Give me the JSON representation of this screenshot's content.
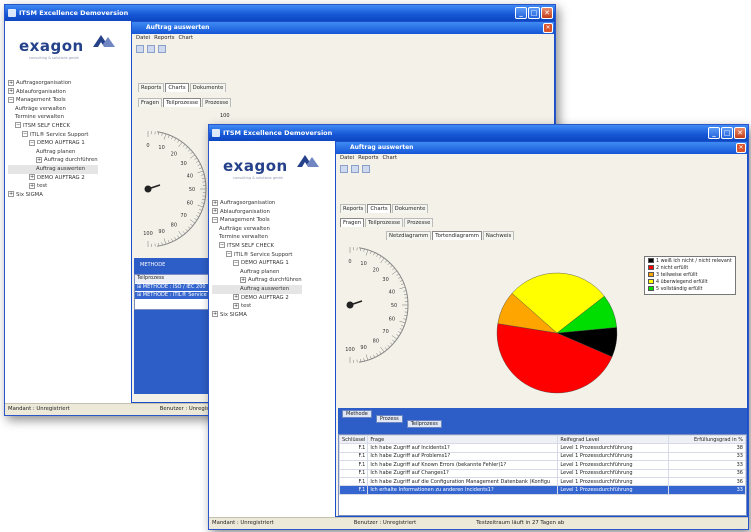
{
  "back": {
    "title": "ITSM Excellence Demoversion",
    "brand": "exagon",
    "tagline": "consulting & solutions gmbh",
    "tree": [
      {
        "label": "Auftragsorganisation",
        "exp": "+",
        "indent": 0
      },
      {
        "label": "Ablauforganisation",
        "exp": "+",
        "indent": 0
      },
      {
        "label": "Management Tools",
        "exp": "−",
        "indent": 0
      },
      {
        "label": "Aufträge verwalten",
        "exp": "",
        "indent": 1
      },
      {
        "label": "Termine verwalten",
        "exp": "",
        "indent": 1
      },
      {
        "label": "ITSM SELF CHECK",
        "exp": "−",
        "indent": 1
      },
      {
        "label": "ITIL® Service Support",
        "exp": "−",
        "indent": 2
      },
      {
        "label": "DEMO AUFTRAG 1",
        "exp": "−",
        "indent": 3
      },
      {
        "label": "Auftrag planen",
        "exp": "",
        "indent": 4
      },
      {
        "label": "Auftrag durchführen",
        "exp": "+",
        "indent": 4
      },
      {
        "label": "Auftrag auswerten",
        "exp": "",
        "indent": 4,
        "sel": true
      },
      {
        "label": "DEMO AUFTRAG 2",
        "exp": "+",
        "indent": 3
      },
      {
        "label": "test",
        "exp": "+",
        "indent": 3
      },
      {
        "label": "Six SIGMA",
        "exp": "+",
        "indent": 0
      }
    ],
    "child_title": "Auftrag auswerten",
    "menu": [
      "Datei",
      "Reports",
      "Chart"
    ],
    "tabs1": [
      "Reports",
      "Charts",
      "Dokumente"
    ],
    "tabs2": [
      "Fragen",
      "Teilprozesse",
      "Prozesse"
    ],
    "top_value": "100",
    "gauge_ticks": [
      "0",
      "10",
      "20",
      "30",
      "40",
      "50",
      "60",
      "70",
      "80",
      "90",
      "100"
    ],
    "grid_label": "METHODE",
    "grid_header": "Teilprozess",
    "grid_rows": [
      "METHODE : ISO / IEC 200",
      "METHODE : ITIL® Service"
    ],
    "status": [
      "Mandant : Unregistriert",
      "Benutzer : Unregistriert"
    ]
  },
  "front": {
    "title": "ITSM Excellence Demoversion",
    "brand": "exagon",
    "tagline": "consulting & solutions gmbh",
    "tree": [
      {
        "label": "Auftragsorganisation",
        "exp": "+",
        "indent": 0
      },
      {
        "label": "Ablauforganisation",
        "exp": "+",
        "indent": 0
      },
      {
        "label": "Management Tools",
        "exp": "−",
        "indent": 0
      },
      {
        "label": "Aufträge verwalten",
        "exp": "",
        "indent": 1
      },
      {
        "label": "Termine verwalten",
        "exp": "",
        "indent": 1
      },
      {
        "label": "ITSM SELF CHECK",
        "exp": "−",
        "indent": 1
      },
      {
        "label": "ITIL® Service Support",
        "exp": "−",
        "indent": 2
      },
      {
        "label": "DEMO AUFTRAG 1",
        "exp": "−",
        "indent": 3
      },
      {
        "label": "Auftrag planen",
        "exp": "",
        "indent": 4
      },
      {
        "label": "Auftrag durchführen",
        "exp": "+",
        "indent": 4
      },
      {
        "label": "Auftrag auswerten",
        "exp": "",
        "indent": 4,
        "sel": true
      },
      {
        "label": "DEMO AUFTRAG 2",
        "exp": "+",
        "indent": 3
      },
      {
        "label": "test",
        "exp": "+",
        "indent": 3
      },
      {
        "label": "Six SIGMA",
        "exp": "+",
        "indent": 0
      }
    ],
    "child_title": "Auftrag auswerten",
    "menu": [
      "Datei",
      "Reports",
      "Chart"
    ],
    "tabs1": [
      "Reports",
      "Charts",
      "Dokumente"
    ],
    "tabs2": [
      "Fragen",
      "Teilprozesse",
      "Prozesse"
    ],
    "tabs3": [
      "Netzdiagramm",
      "Tortendiagramm",
      "Nachweis"
    ],
    "gauge_ticks": [
      "0",
      "10",
      "20",
      "30",
      "40",
      "50",
      "60",
      "70",
      "80",
      "90",
      "100"
    ],
    "legend": [
      {
        "label": "1 weiß ich nicht / nicht relevant",
        "color": "#000000"
      },
      {
        "label": "2 nicht erfüllt",
        "color": "#ff0000"
      },
      {
        "label": "3 teilweise erfüllt",
        "color": "#ffa500"
      },
      {
        "label": "4 überwiegend erfüllt",
        "color": "#ffff00"
      },
      {
        "label": "5 vollständig erfüllt",
        "color": "#00dd00"
      }
    ],
    "filters": [
      "Methode",
      "Prozess",
      "Teilprozess"
    ],
    "columns": [
      "Schlüssel",
      "Frage",
      "Reifegrad Level",
      "Erfüllungsgrad in %"
    ],
    "rows": [
      {
        "key": "F.1",
        "q": "Ich habe Zugriff auf Incidents1?",
        "level": "Level 1 Prozessdurchführung",
        "pct": "38"
      },
      {
        "key": "F.1",
        "q": "Ich habe Zugriff auf Problems1?",
        "level": "Level 1 Prozessdurchführung",
        "pct": "33"
      },
      {
        "key": "F.1",
        "q": "Ich habe Zugriff auf Known Errors (bekannte Fehler)1?",
        "level": "Level 1 Prozessdurchführung",
        "pct": "33"
      },
      {
        "key": "F.1",
        "q": "Ich habe Zugriff auf Changes1?",
        "level": "Level 1 Prozessdurchführung",
        "pct": "36"
      },
      {
        "key": "F.1",
        "q": "Ich habe Zugriff auf die Configuration Management Datenbank (Konfigu",
        "level": "Level 1 Prozessdurchführung",
        "pct": "36"
      },
      {
        "key": "F.1",
        "q": "Ich erhalte Informationen zu anderen Incidents1?",
        "level": "Level 1 Prozessdurchführung",
        "pct": "33",
        "hl": true
      }
    ],
    "status": [
      "Mandant : Unregistriert",
      "Benutzer : Unregistriert",
      "Testzeitraum läuft in 27 Tagen ab"
    ],
    "chart_data": {
      "type": "pie",
      "categories": [
        "1 weiß ich nicht / nicht relevant",
        "2 nicht erfüllt",
        "3 teilweise erfüllt",
        "4 überwiegend erfüllt",
        "5 vollständig erfüllt"
      ],
      "values": [
        8,
        46,
        9,
        28,
        9
      ],
      "colors": [
        "#000000",
        "#ff0000",
        "#ffa500",
        "#ffff00",
        "#00dd00"
      ]
    }
  }
}
